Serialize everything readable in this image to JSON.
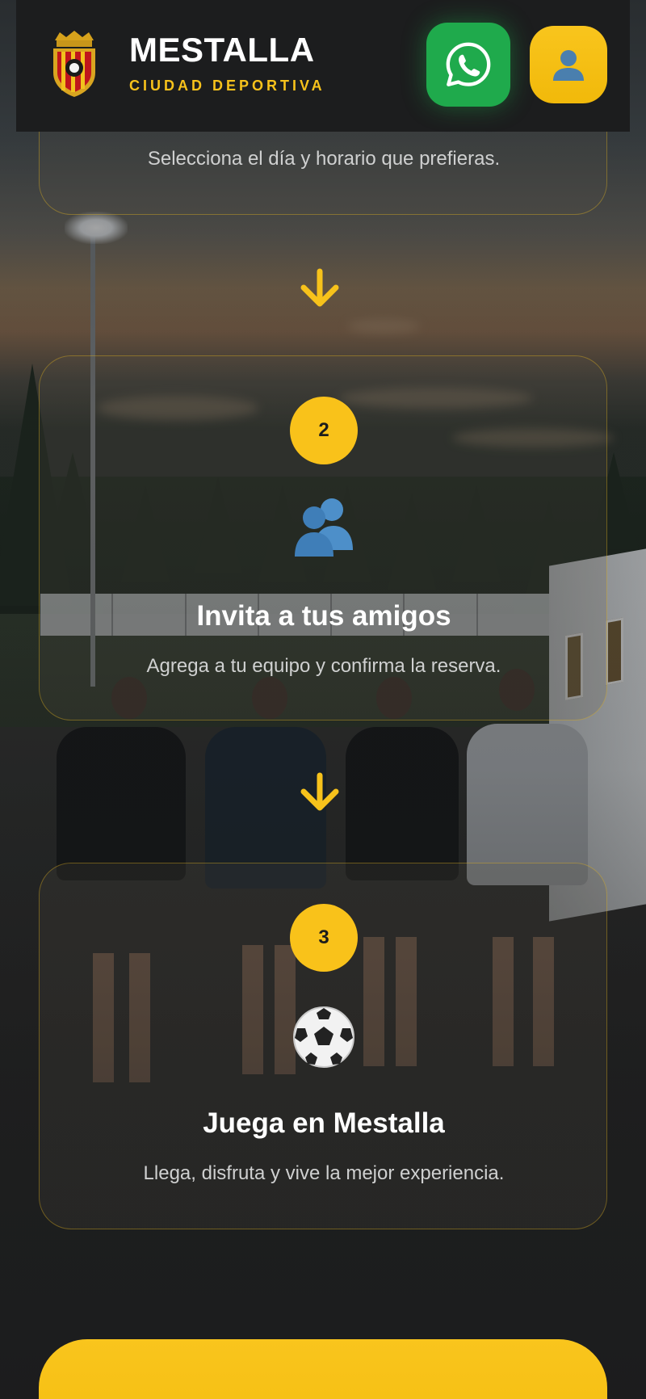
{
  "header": {
    "title": "MESTALLA",
    "subtitle": "CIUDAD DEPORTIVA",
    "whatsapp_icon": "whatsapp-icon",
    "user_icon": "user-icon",
    "accent_color": "#f7c21b",
    "whatsapp_color": "#1faa4c"
  },
  "steps": [
    {
      "number": "",
      "icon": "calendar-icon",
      "title": "",
      "description": "Selecciona el día y horario que prefieras."
    },
    {
      "number": "2",
      "icon": "two-people-icon",
      "title": "Invita a tus amigos",
      "description": "Agrega a tu equipo y confirma la reserva."
    },
    {
      "number": "3",
      "icon": "soccer-ball-icon",
      "title": "Juega en Mestalla",
      "description": "Llega, disfruta y vive la mejor experiencia."
    }
  ],
  "connectors": [
    "arrow-down-icon",
    "arrow-down-icon"
  ],
  "cta": {
    "label": ""
  }
}
